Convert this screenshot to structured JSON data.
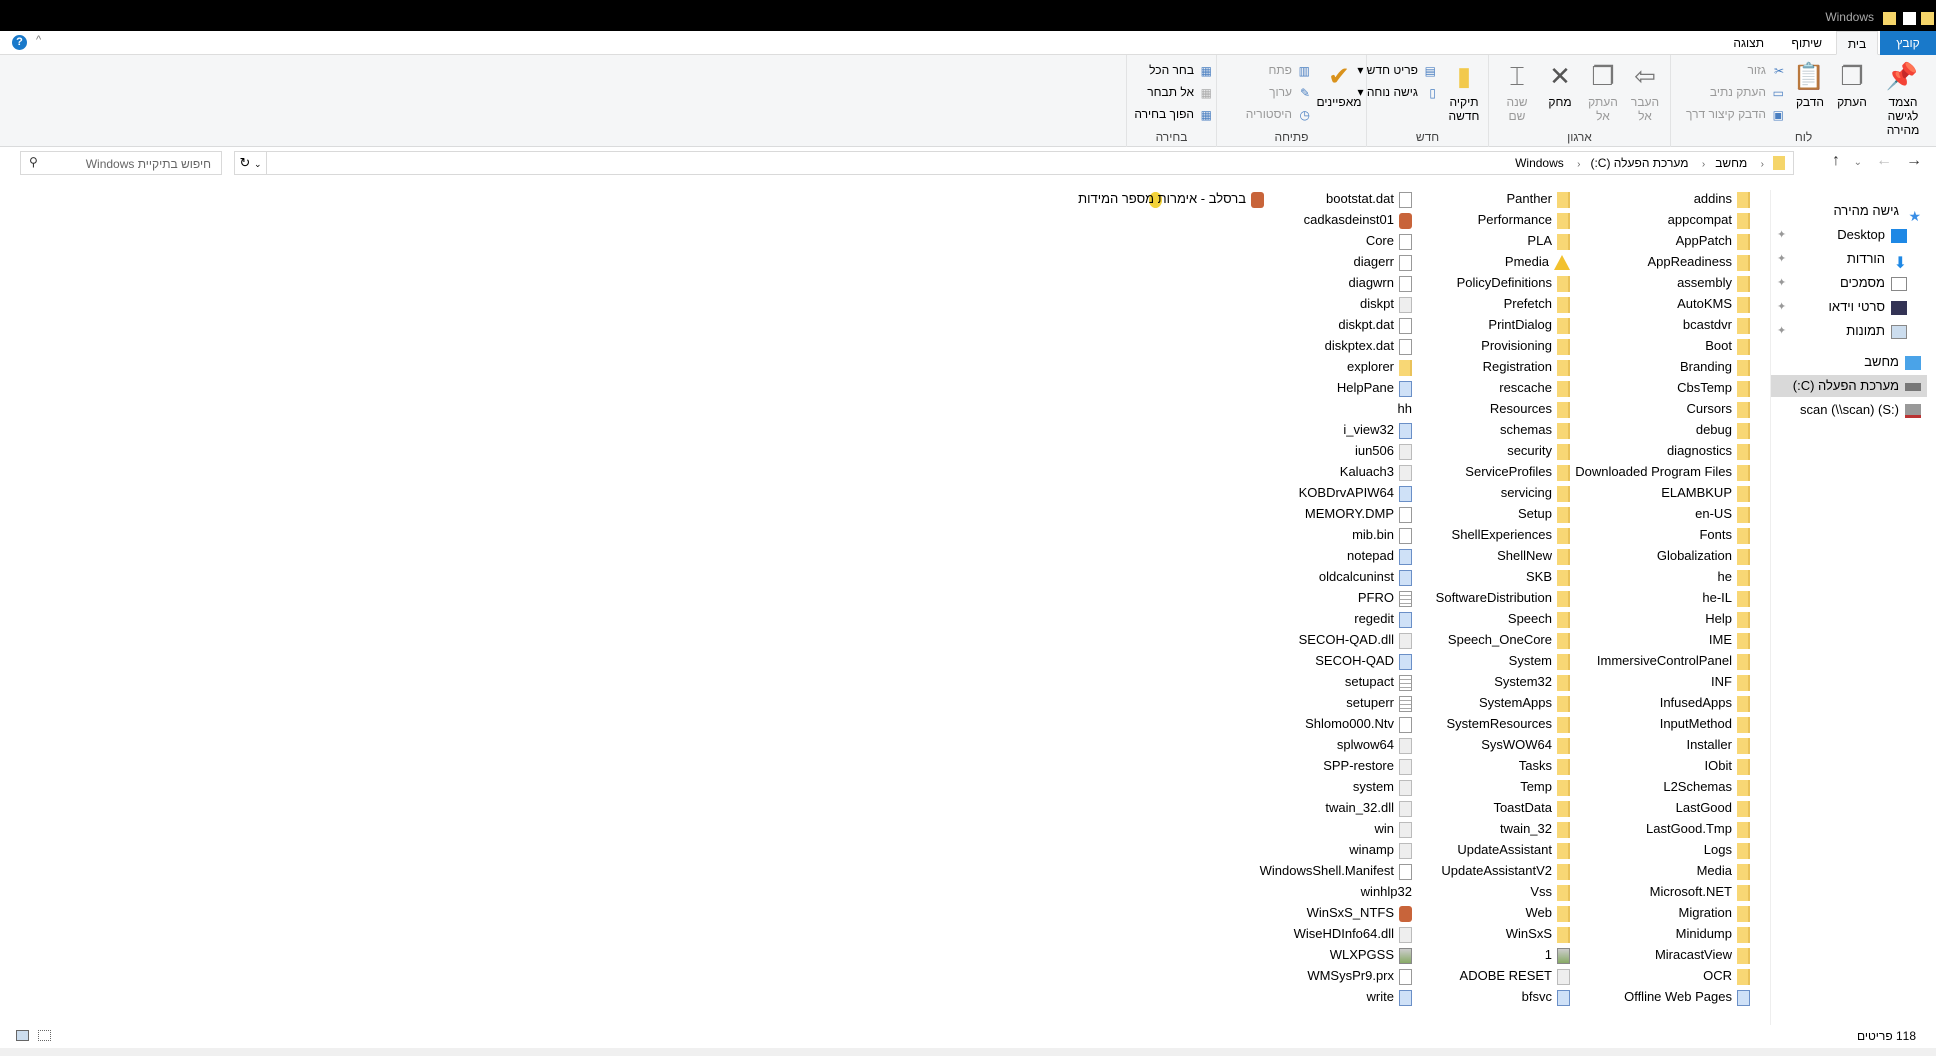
{
  "titlebar": {
    "title": "Windows"
  },
  "ribbon_tabs": {
    "file": "קובץ",
    "home": "בית",
    "share": "שיתוף",
    "view": "תצוגה"
  },
  "ribbon": {
    "clipboard": {
      "label": "לוח",
      "pin": "הצמד לגישה מהירה",
      "copy": "העתק",
      "paste": "הדבק",
      "cut": "גזור",
      "copy_path": "העתק נתיב",
      "paste_shortcut": "הדבק קיצור דרך"
    },
    "organize": {
      "label": "ארגון",
      "move_to": "העבר אל",
      "copy_to": "העתק אל",
      "delete": "מחק",
      "rename": "שנה שם"
    },
    "new": {
      "label": "חדש",
      "new_folder": "תיקיה חדשה",
      "new_item": "פריט חדש",
      "easy_access": "גישה נוחה"
    },
    "open": {
      "label": "פתיחה",
      "properties": "מאפיינים",
      "open": "פתח",
      "edit": "ערוך",
      "history": "היסטוריה"
    },
    "select": {
      "label": "בחירה",
      "select_all": "בחר הכל",
      "select_none": "אל תבחר",
      "invert": "הפוך בחירה"
    }
  },
  "address": {
    "crumbs": [
      "מחשב",
      "מערכת הפעלה (C:)",
      "Windows"
    ]
  },
  "search": {
    "placeholder": "חיפוש בתיקיית Windows"
  },
  "nav": {
    "quick_access": "גישה מהירה",
    "items": [
      "Desktop",
      "הורדות",
      "מסמכים",
      "סרטי וידאו",
      "תמונות"
    ],
    "computer": "מחשב",
    "drive_c": "מערכת הפעלה (C:)",
    "drive_s": "scan (\\\\scan) (S:)"
  },
  "columns": [
    [
      [
        "addins",
        "folder"
      ],
      [
        "appcompat",
        "folder"
      ],
      [
        "AppPatch",
        "folder"
      ],
      [
        "AppReadiness",
        "folder"
      ],
      [
        "assembly",
        "folder"
      ],
      [
        "AutoKMS",
        "folder"
      ],
      [
        "bcastdvr",
        "folder"
      ],
      [
        "Boot",
        "folder"
      ],
      [
        "Branding",
        "folder"
      ],
      [
        "CbsTemp",
        "folder"
      ],
      [
        "Cursors",
        "folder"
      ],
      [
        "debug",
        "folder"
      ],
      [
        "diagnostics",
        "folder"
      ],
      [
        "Downloaded Program Files",
        "folder"
      ],
      [
        "ELAMBKUP",
        "folder"
      ],
      [
        "en-US",
        "folder"
      ],
      [
        "Fonts",
        "folder"
      ],
      [
        "Globalization",
        "folder"
      ],
      [
        "he",
        "folder"
      ],
      [
        "he-IL",
        "folder"
      ],
      [
        "Help",
        "folder"
      ],
      [
        "IME",
        "folder"
      ],
      [
        "ImmersiveControlPanel",
        "folder"
      ],
      [
        "INF",
        "folder"
      ],
      [
        "InfusedApps",
        "folder"
      ],
      [
        "InputMethod",
        "folder"
      ],
      [
        "Installer",
        "folder"
      ],
      [
        "IObit",
        "folder"
      ],
      [
        "L2Schemas",
        "folder"
      ],
      [
        "LastGood",
        "folder"
      ],
      [
        "LastGood.Tmp",
        "folder"
      ],
      [
        "Logs",
        "folder"
      ],
      [
        "Media",
        "folder"
      ],
      [
        "Microsoft.NET",
        "folder"
      ],
      [
        "Migration",
        "folder"
      ],
      [
        "Minidump",
        "folder"
      ],
      [
        "MiracastView",
        "folder"
      ],
      [
        "OCR",
        "folder"
      ],
      [
        "Offline Web Pages",
        "app"
      ]
    ],
    [
      [
        "Panther",
        "folder"
      ],
      [
        "Performance",
        "folder"
      ],
      [
        "PLA",
        "folder"
      ],
      [
        "Pmedia",
        "warn"
      ],
      [
        "PolicyDefinitions",
        "folder"
      ],
      [
        "Prefetch",
        "folder"
      ],
      [
        "PrintDialog",
        "folder"
      ],
      [
        "Provisioning",
        "folder"
      ],
      [
        "Registration",
        "folder"
      ],
      [
        "rescache",
        "folder"
      ],
      [
        "Resources",
        "folder"
      ],
      [
        "schemas",
        "folder"
      ],
      [
        "security",
        "folder"
      ],
      [
        "ServiceProfiles",
        "folder"
      ],
      [
        "servicing",
        "folder"
      ],
      [
        "Setup",
        "folder"
      ],
      [
        "ShellExperiences",
        "folder"
      ],
      [
        "ShellNew",
        "folder"
      ],
      [
        "SKB",
        "folder"
      ],
      [
        "SoftwareDistribution",
        "folder"
      ],
      [
        "Speech",
        "folder"
      ],
      [
        "Speech_OneCore",
        "folder"
      ],
      [
        "System",
        "folder"
      ],
      [
        "System32",
        "folder"
      ],
      [
        "SystemApps",
        "folder"
      ],
      [
        "SystemResources",
        "folder"
      ],
      [
        "SysWOW64",
        "folder"
      ],
      [
        "Tasks",
        "folder"
      ],
      [
        "Temp",
        "folder"
      ],
      [
        "ToastData",
        "folder"
      ],
      [
        "twain_32",
        "folder"
      ],
      [
        "UpdateAssistant",
        "folder"
      ],
      [
        "UpdateAssistantV2",
        "folder"
      ],
      [
        "Vss",
        "folder"
      ],
      [
        "Web",
        "folder"
      ],
      [
        "WinSxS",
        "folder"
      ],
      [
        "1",
        "img"
      ],
      [
        "ADOBE RESET",
        "dll"
      ],
      [
        "bfsvc",
        "app"
      ]
    ],
    [
      [
        "bootstat.dat",
        "file"
      ],
      [
        "cadkasdeinst01",
        "special"
      ],
      [
        "Core",
        "file"
      ],
      [
        "diagerr",
        "file"
      ],
      [
        "diagwrn",
        "file"
      ],
      [
        "diskpt",
        "dll"
      ],
      [
        "diskpt.dat",
        "file"
      ],
      [
        "diskptex.dat",
        "file"
      ],
      [
        "explorer",
        "folder"
      ],
      [
        "HelpPane",
        "app"
      ],
      [
        "hh",
        "help"
      ],
      [
        "i_view32",
        "app"
      ],
      [
        "iun506",
        "dll"
      ],
      [
        "Kaluach3",
        "dll"
      ],
      [
        "KOBDrvAPIW64",
        "app"
      ],
      [
        "MEMORY.DMP",
        "file"
      ],
      [
        "mib.bin",
        "file"
      ],
      [
        "notepad",
        "app"
      ],
      [
        "oldcalcuninst",
        "app"
      ],
      [
        "PFRO",
        "text"
      ],
      [
        "regedit",
        "app"
      ],
      [
        "SECOH-QAD.dll",
        "dll"
      ],
      [
        "SECOH-QAD",
        "app"
      ],
      [
        "setupact",
        "text"
      ],
      [
        "setuperr",
        "text"
      ],
      [
        "Shlomo000.Ntv",
        "file"
      ],
      [
        "splwow64",
        "dll"
      ],
      [
        "SPP-restore",
        "dll"
      ],
      [
        "system",
        "dll"
      ],
      [
        "twain_32.dll",
        "dll"
      ],
      [
        "win",
        "dll"
      ],
      [
        "winamp",
        "dll"
      ],
      [
        "WindowsShell.Manifest",
        "file"
      ],
      [
        "winhlp32",
        "help"
      ],
      [
        "WinSxS_NTFS",
        "special"
      ],
      [
        "WiseHDInfo64.dll",
        "dll"
      ],
      [
        "WLXPGSS",
        "img"
      ],
      [
        "WMSysPr9.prx",
        "file"
      ],
      [
        "write",
        "app"
      ]
    ],
    [
      [
        "ברסלב - אימרות מספר המידות",
        "special"
      ]
    ]
  ],
  "status": {
    "count": "118 פריטים"
  }
}
